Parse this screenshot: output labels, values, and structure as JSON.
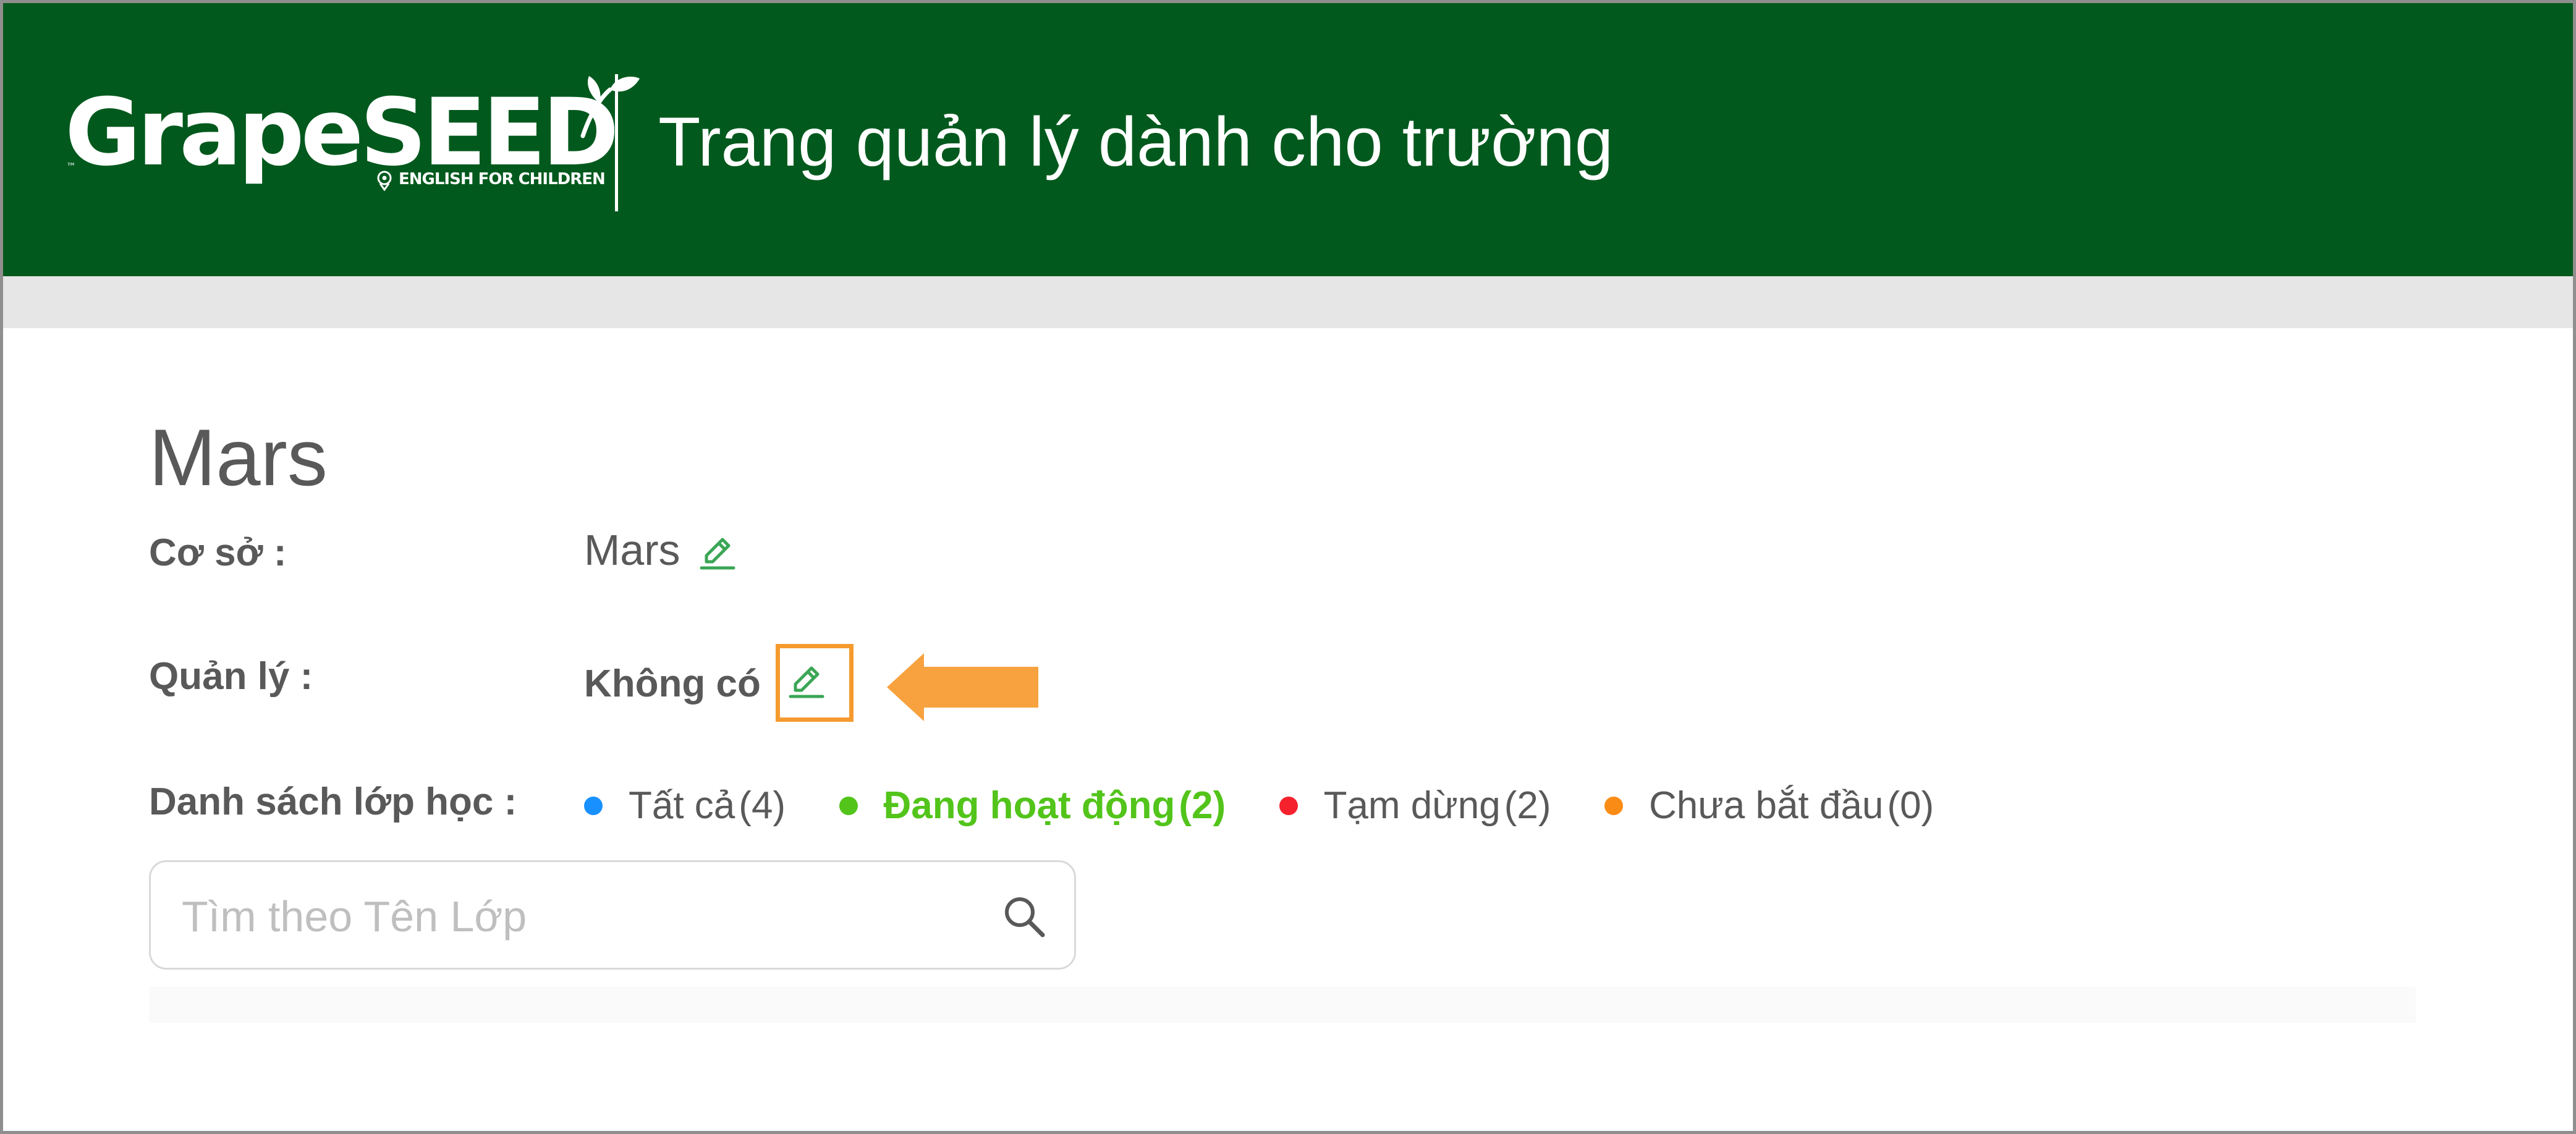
{
  "header": {
    "logo_text": "GrapeSEED",
    "logo_tm": "™",
    "logo_sub": "ENGLISH FOR CHILDREN",
    "title": "Trang quản lý dành cho trường"
  },
  "page": {
    "title": "Mars"
  },
  "details": {
    "campus_label": "Cơ sở :",
    "campus_value": "Mars",
    "manager_label": "Quản lý :",
    "manager_value": "Không có",
    "classes_label": "Danh sách lớp học :"
  },
  "filters": [
    {
      "label": "Tất cả",
      "count": "(4)",
      "color": "#1890ff",
      "active": false
    },
    {
      "label": "Đang hoạt động",
      "count": "(2)",
      "color": "#52c41a",
      "active": true
    },
    {
      "label": "Tạm dừng",
      "count": "(2)",
      "color": "#f5222d",
      "active": false
    },
    {
      "label": "Chưa bắt đầu",
      "count": "(0)",
      "color": "#fa8c16",
      "active": false
    }
  ],
  "search": {
    "placeholder": "Tìm theo Tên Lớp",
    "value": ""
  },
  "icons": {
    "campus_edit": "pencil-icon",
    "manager_edit": "pencil-icon",
    "search": "search-icon",
    "callout": "arrow-left-icon"
  },
  "colors": {
    "header_bg": "#01591d",
    "accent_green": "#52c41a",
    "edit_icon": "#3aa655",
    "highlight": "#f59a2e"
  }
}
